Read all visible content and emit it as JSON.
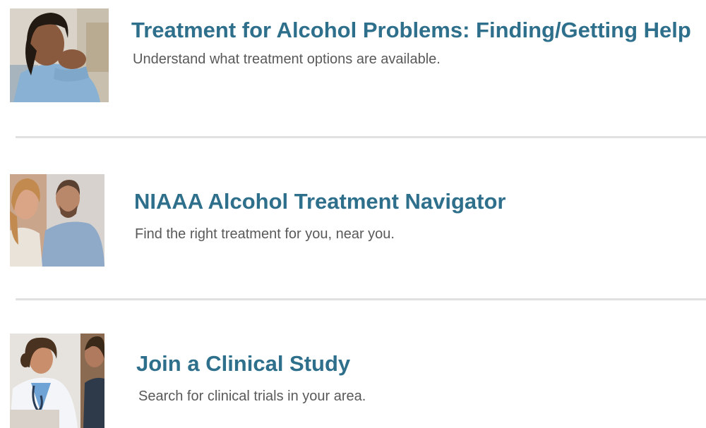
{
  "items": [
    {
      "title": "Treatment for Alcohol Problems: Finding/Getting Help",
      "description": "Understand what treatment options are available."
    },
    {
      "title": "NIAAA Alcohol Treatment Navigator",
      "description": "Find the right treatment for you, near you."
    },
    {
      "title": "Join a Clinical Study",
      "description": "Search for clinical trials in your area."
    }
  ],
  "colors": {
    "title": "#2e6f8c",
    "description": "#595959",
    "divider": "#e1e1e1"
  }
}
